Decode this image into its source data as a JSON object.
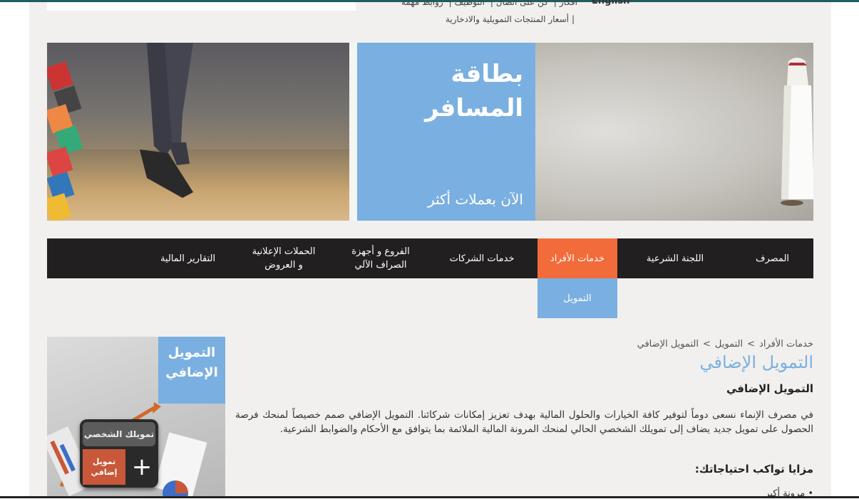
{
  "header": {
    "top_links_row1": [
      "English",
      "أفكار",
      "كن على اتصال",
      "التوظيف",
      "روابط مهمة"
    ],
    "top_links_row2": "أسعار المنتجات التمويلية والادخارية",
    "lang": "English"
  },
  "banner": {
    "title_line1": "بطاقة",
    "title_line2": "المسافر",
    "subtitle": "الآن بعملات أكثر"
  },
  "nav": {
    "items": [
      "المصرف",
      "اللجنة الشرعية",
      "خدمات الأفراد",
      "خدمات الشركات",
      "الفروع و أجهزة الصراف الآلي",
      "الحملات الإعلانية و العروض",
      "التقارير المالية"
    ],
    "item_line1": [
      "المصرف",
      "اللجنة الشرعية",
      "خدمات الأفراد",
      "خدمات الشركات",
      "الفروع و أجهزة",
      "الحملات الإعلانية",
      "التقارير المالية"
    ],
    "item_line2": [
      "",
      "",
      "",
      "",
      "الصراف الآلي",
      "و العروض",
      ""
    ],
    "active": "خدمات الأفراد",
    "submenu_label": "التمويل"
  },
  "breadcrumb": {
    "items": [
      "خدمات الأفراد",
      "التمويل",
      "التمويل الإضافي"
    ],
    "separator": ">"
  },
  "content": {
    "page_title": "التمويل الإضافي",
    "sub_heading": "التمويل الإضافي",
    "paragraph": "في مصرف الإنماء نسعى دوماً لتوفير كافة الخيارات والحلول المالية بهدف تعزيز إمكانات شركائنا. التمويل الإضافي صمم خصيصاً لمنحك فرصة الحصول على تمويل جديد يضاف إلى تمويلك الشخصي الحالي لمنحك المرونة المالية الملائمة بما يتوافق مع الأحكام والضوابط الشرعية.",
    "features_heading": "مزايا تواكب احتياجاتك:",
    "list_first_item": "مرونة أكبر"
  },
  "promo": {
    "title_line1": "التمويل",
    "title_line2": "الإضافي",
    "card_top": "تمويلك الشخصي",
    "card_bottom_line1": "تمويل",
    "card_bottom_line2": "إضافي",
    "plus": "+"
  },
  "colors": {
    "accent_blue": "#7aafe1",
    "active_orange": "#f26b3a",
    "nav_bg": "#211f1f",
    "page_bg": "#f1f0ee"
  }
}
